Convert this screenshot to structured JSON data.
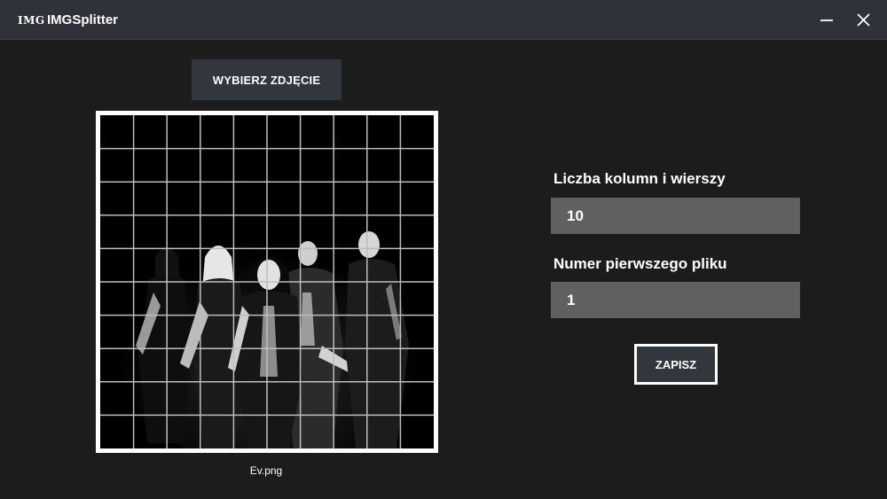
{
  "titlebar": {
    "logo_text": "IMG",
    "title": "IMGSplitter",
    "minimize_icon": "minimize-icon",
    "close_icon": "close-icon"
  },
  "choose_button": {
    "label": "WYBIERZ ZDJĘCIE"
  },
  "preview": {
    "file_name": "Ev.png",
    "grid_divisions": 10,
    "grid_color": "#bdbdbd",
    "border_color": "#ffffff"
  },
  "settings": {
    "columns_label": "Liczba kolumn i wierszy",
    "columns_value": "10",
    "first_file_label": "Numer pierwszego pliku",
    "first_file_value": "1"
  },
  "save_button": {
    "label": "ZAPISZ"
  },
  "colors": {
    "background": "#1c1c1c",
    "titlebar": "#2f3238",
    "button": "#32363d",
    "input": "#606060"
  }
}
